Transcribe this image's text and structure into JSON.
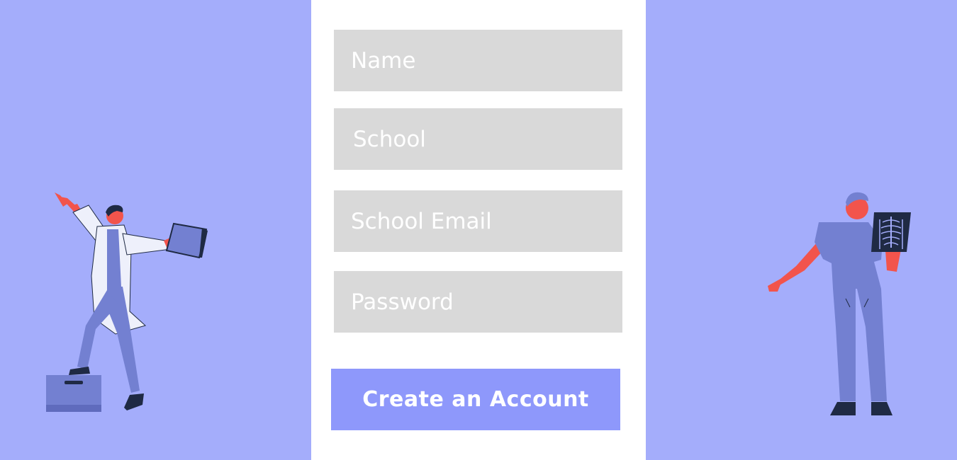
{
  "form": {
    "name_placeholder": "Name",
    "school_placeholder": "School",
    "email_placeholder": "School Email",
    "password_placeholder": "Password",
    "submit_label": "Create an Account"
  },
  "theme": {
    "background": "#a4adfb",
    "panel": "#ffffff",
    "field_fill": "#d9d9d9",
    "button_fill": "#8e98fb",
    "skin": "#f2544c",
    "scrubs": "#7380d1",
    "dark": "#1f2a44"
  },
  "illustrations": {
    "left": "doctor-with-clipboard-illustration",
    "right": "doctor-with-xray-illustration"
  }
}
